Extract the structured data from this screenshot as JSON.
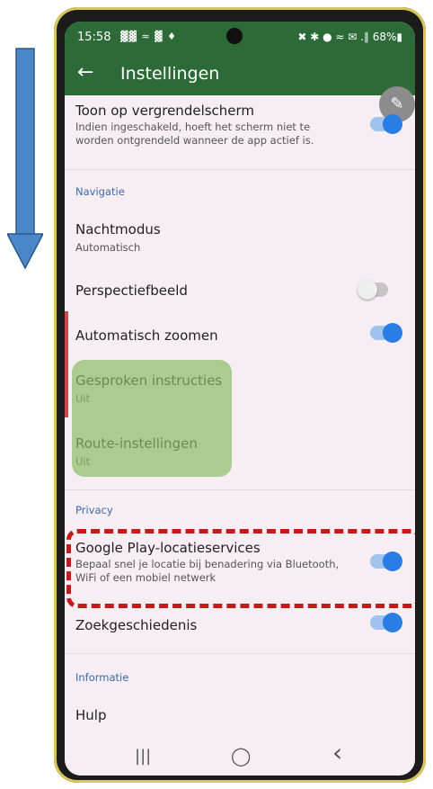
{
  "status_bar": {
    "time": "15:58",
    "notification_icons": "▓▓ ≈ ▓ ♦",
    "right_icons": "✖ ✱ ● ≈ ✉ .∥ 68%▮"
  },
  "app_bar": {
    "back_icon": "←",
    "title": "Instellingen"
  },
  "fab_icon": "✎",
  "settings": {
    "lock_screen": {
      "title": "Toon op vergrendelscherm",
      "subtitle": "Indien ingeschakeld, hoeft het scherm niet te worden ontgrendeld wanneer de app actief is.",
      "enabled": true
    },
    "navigation_header": "Navigatie",
    "night_mode": {
      "title": "Nachtmodus",
      "subtitle": "Automatisch"
    },
    "perspective": {
      "title": "Perspectiefbeeld",
      "enabled": false
    },
    "auto_zoom": {
      "title": "Automatisch zoomen",
      "enabled": true
    },
    "voice": {
      "title": "Gesproken instructies",
      "subtitle": "Uit"
    },
    "route": {
      "title": "Route-instellingen",
      "subtitle": "Uit"
    },
    "privacy_header": "Privacy",
    "location_services": {
      "title": "Google Play-locatieservices",
      "subtitle": "Bepaal snel je locatie bij benadering via Bluetooth, WiFi of een mobiel netwerk",
      "enabled": true
    },
    "search_history": {
      "title": "Zoekgeschiedenis",
      "enabled": true
    },
    "info_header": "Informatie",
    "help": {
      "title": "Hulp"
    }
  },
  "nav_bar": {
    "recent": "|||",
    "home": "◯",
    "back": "‹"
  },
  "colors": {
    "app_bar": "#2c6b37",
    "toggle_on": "#2b7de6",
    "section_header": "#3c69a8",
    "highlight_green": "#a6c98a",
    "highlight_red": "#c41a1a",
    "arrow": "#4a86c8"
  }
}
